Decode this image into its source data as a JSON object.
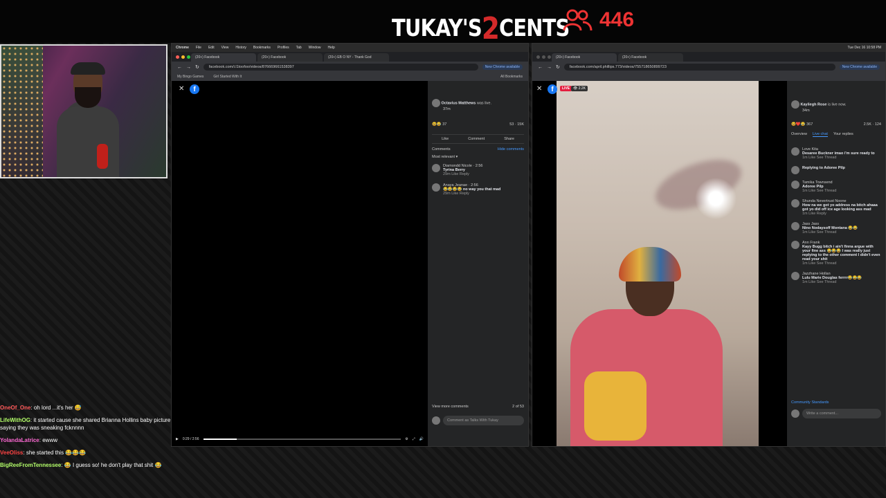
{
  "overlay": {
    "brand_left": "TUKAY'S",
    "brand_mid": "2",
    "brand_right": "CENTS",
    "viewer_count": "446",
    "viewer_icon": "people-icon",
    "accent_color": "#e02a2a"
  },
  "chat": [
    {
      "user": "OneOf_One",
      "user_color": "#ff5a5a",
      "text": "oh lord ...it's her 😅"
    },
    {
      "user": "LifeWithOG",
      "user_color": "#b4ff6a",
      "text": "it started cause she shared Brianna Hollins baby picture saying they was sneaking fcknnnn"
    },
    {
      "user": "YolandaLatrice",
      "user_color": "#ff6ad5",
      "text": "ewww"
    },
    {
      "user": "VeeOliss",
      "user_color": "#ff4444",
      "text": "she started this 😂😂😂"
    },
    {
      "user": "BigReeFromTennessee",
      "user_color": "#b4ff6a",
      "text": "😂 I guess so! he don't play that shit 😂"
    }
  ],
  "left_browser": {
    "menu": [
      "Chrome",
      "File",
      "Edit",
      "View",
      "History",
      "Bookmarks",
      "Profiles",
      "Tab",
      "Window",
      "Help"
    ],
    "tabs": [
      "(20+) Facebook",
      "(20+) Facebook",
      "(20+) EB O NY - Thank God"
    ],
    "url": "facebook.com/i.l1toofoo/videos/876669661538397",
    "update_label": "New Chrome available",
    "bookmarks": [
      "My Bingo Games",
      "Girl Started With It",
      "All Bookmarks"
    ],
    "time": "0:29 / 2:56",
    "progress": 0.17,
    "post_author": "Octavius Matthews",
    "post_status": "was live.",
    "post_time": "37m",
    "reaction_count": "37",
    "share_count": "53",
    "views": "15K",
    "actions": [
      "Like",
      "Comment",
      "Share"
    ],
    "comments_header": "Comments",
    "hide_comments": "Hide comments",
    "most_relevant": "Most relevant",
    "comments": [
      {
        "author": "Diamondd Nicole",
        "time": "2:56",
        "text": "Tyrina Berry",
        "meta": "29m  Like  Reply"
      },
      {
        "author": "Anaya Jeanae",
        "time": "2:56",
        "text": "😂😂😂😂 no way you that mad",
        "meta": "29m  Like  Reply"
      }
    ],
    "view_more": "View more comments",
    "count_of": "2 of 53",
    "comment_placeholder": "Comment as Talks With Tukay"
  },
  "right_browser": {
    "tabs": [
      "(20+) Facebook",
      "(20+) Facebook"
    ],
    "url": "facebook.com/april.phillips.773/videos/755718650899723",
    "update_label": "New Chrome available",
    "clock": "Tue Dec 16  10:58 PM",
    "live_badge": "LIVE",
    "live_viewers": "2.2K",
    "host": "Kayliegh Rose",
    "host_status": "is live now.",
    "host_time": "34m",
    "reactions": "367",
    "views": "2.5K",
    "shares": "124",
    "tabs_chat": [
      "Overview",
      "Live chat",
      "Your replies"
    ],
    "chat": [
      {
        "author": "Love Kita",
        "text": "Desaree Buckner imao i'm sure ready to",
        "meta": "1m  Like  See Thread"
      },
      {
        "author": "",
        "text": "Replying to Adoree Pilp",
        "meta": ""
      },
      {
        "author": "Tamika Townsend",
        "text": "Adoree Pilp",
        "meta": "1m  Like  See Thread"
      },
      {
        "author": "Shunda Nevertrust Noone",
        "text": "How na we got yo address na bitch ahaaa got yo did off ice age looking ass mad",
        "meta": "1m  Like  Reply"
      },
      {
        "author": "Jass Jass",
        "text": "Nino Nodaysoff Montana 😂😂",
        "meta": "1m  Like  See Thread"
      },
      {
        "author": "Ann Frank",
        "text": "Kayy Bugg bitch i ain't finna argue with your fine ass 😂😂😂 I was really just replying to the other comment I didn't even read your shit",
        "meta": "1m  Like  See Thread"
      },
      {
        "author": "Jazzhane Hollan",
        "text": "Lulu Marie Douglas ferrrr😂😂😂",
        "meta": "1m  Like  See Thread"
      }
    ],
    "community": "Community Standards",
    "comment_placeholder": "Write a comment..."
  }
}
